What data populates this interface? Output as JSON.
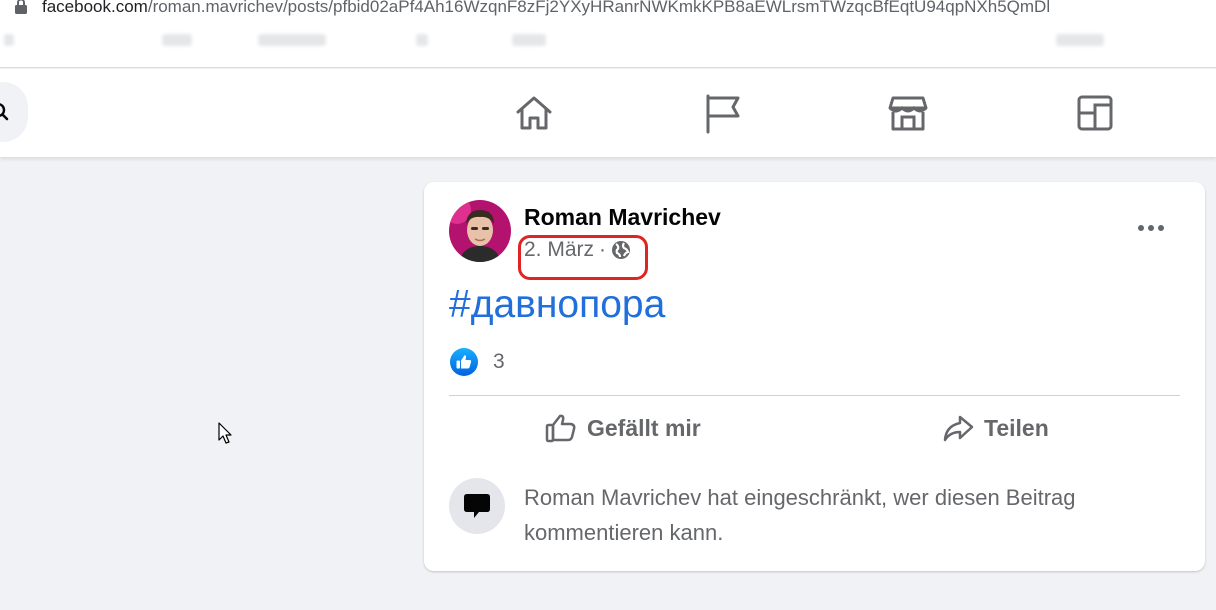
{
  "browser": {
    "url_host": "facebook.com",
    "url_path": "/roman.mavrichev/posts/pfbid02aPf4Ah16WzqnF8zFj2YXyHRanrNWKmkKPB8aEWLrsmTWzqcBfEqtU94qpNXh5QmDl"
  },
  "nav": {
    "icons": [
      "search-icon",
      "home-icon",
      "pages-flag-icon",
      "marketplace-icon",
      "gaming-icon"
    ]
  },
  "post": {
    "author": "Roman Mavrichev",
    "date": "2. März",
    "separator": "·",
    "audience_icon": "globe-icon",
    "hashtag": "#давнопора",
    "reaction_count": "3",
    "like_label": "Gefällt mir",
    "share_label": "Teilen",
    "comment_restriction": "Roman Mavrichev hat eingeschränkt, wer diesen Beitrag kommentieren kann."
  },
  "colors": {
    "link_blue": "#216fdb",
    "secondary_text": "#65676b",
    "highlight_red": "#e02424",
    "background": "#f0f2f5"
  }
}
